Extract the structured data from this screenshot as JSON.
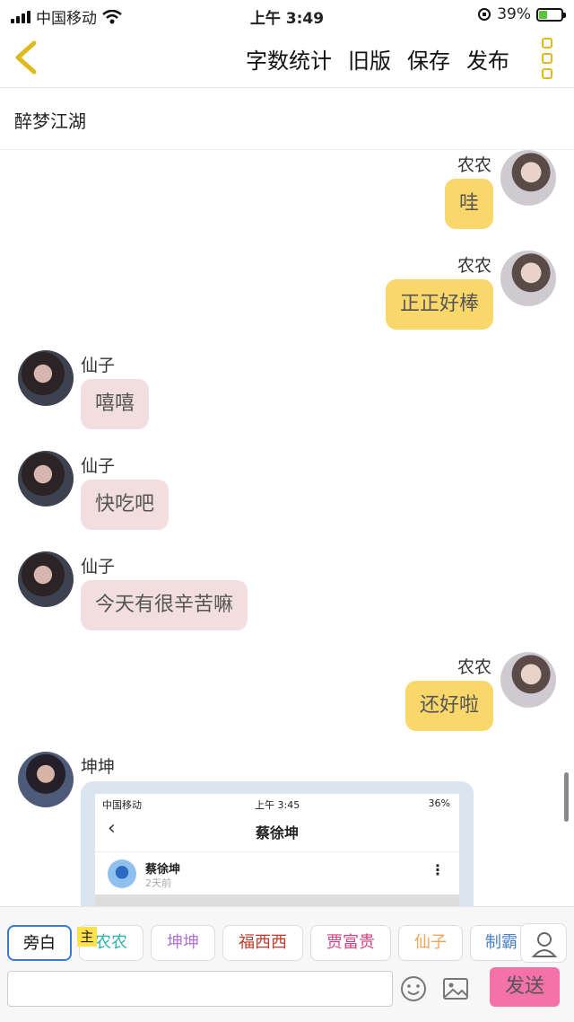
{
  "status_bar": {
    "carrier": "中国移动",
    "time": "上午 3:49",
    "battery": "39%"
  },
  "nav": {
    "actions": [
      "字数统计",
      "旧版",
      "保存",
      "发布"
    ]
  },
  "title": "醉梦江湖",
  "messages": [
    {
      "side": "right",
      "name": "农农",
      "text": "哇",
      "avatar": "avatar-nongnong"
    },
    {
      "side": "right",
      "name": "农农",
      "text": "正正好棒",
      "avatar": "avatar-nongnong"
    },
    {
      "side": "left",
      "name": "仙子",
      "text": "嘻嘻",
      "avatar": "avatar-xianzi"
    },
    {
      "side": "left",
      "name": "仙子",
      "text": "快吃吧",
      "avatar": "avatar-xianzi"
    },
    {
      "side": "left",
      "name": "仙子",
      "text": "今天有很辛苦嘛",
      "avatar": "avatar-xianzi"
    },
    {
      "side": "right",
      "name": "农农",
      "text": "还好啦",
      "avatar": "avatar-nongnong"
    },
    {
      "side": "left",
      "name": "坤坤",
      "avatar": "avatar-kunkun"
    }
  ],
  "shared_screenshot": {
    "carrier": "中国移动",
    "time": "上午 3:45",
    "battery": "36%",
    "title": "蔡徐坤",
    "author": "蔡徐坤",
    "time_ago": "2天前"
  },
  "roles": {
    "badge": "主",
    "items": [
      {
        "label": "旁白",
        "color": "#222222"
      },
      {
        "label": "农农",
        "color": "#2bb5a8"
      },
      {
        "label": "坤坤",
        "color": "#b072d6"
      },
      {
        "label": "福西西",
        "color": "#c0392b"
      },
      {
        "label": "贾富贵",
        "color": "#d63f7e"
      },
      {
        "label": "仙子",
        "color": "#f0a35a"
      },
      {
        "label": "制霸",
        "color": "#4a7fc8"
      }
    ]
  },
  "composer": {
    "send_label": "发送",
    "placeholder": ""
  }
}
